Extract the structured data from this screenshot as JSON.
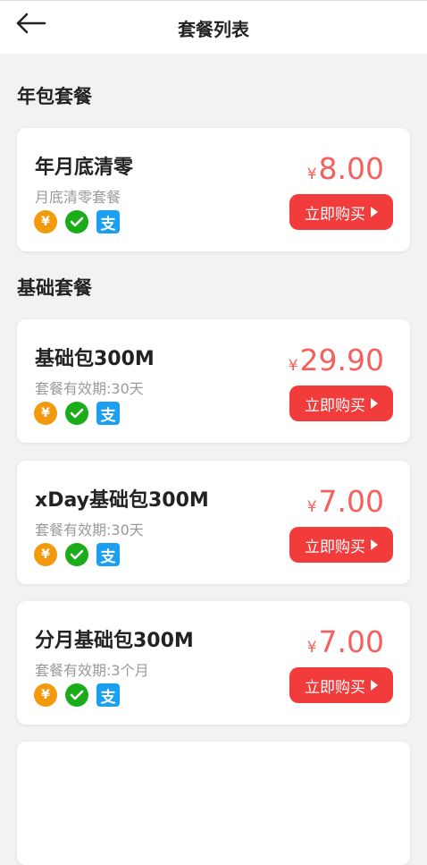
{
  "header": {
    "title": "套餐列表",
    "back_icon": "arrow-left-icon"
  },
  "sections": [
    {
      "title": "年包套餐",
      "cards": [
        {
          "name": "年月底清零",
          "subtitle": "月底清零套餐",
          "currency": "¥",
          "price": "8.00",
          "button": "立即购买"
        }
      ]
    },
    {
      "title": "基础套餐",
      "cards": [
        {
          "name": "基础包300M",
          "subtitle": "套餐有效期:30天",
          "currency": "¥",
          "price": "29.90",
          "button": "立即购买"
        },
        {
          "name": "xDay基础包300M",
          "subtitle": "套餐有效期:30天",
          "currency": "¥",
          "price": "7.00",
          "button": "立即购买"
        },
        {
          "name": "分月基础包300M",
          "subtitle": "套餐有效期:3个月",
          "currency": "¥",
          "price": "7.00",
          "button": "立即购买"
        }
      ]
    }
  ],
  "payment_icons": {
    "balance": "¥",
    "wechat": "wechat-pay-icon",
    "alipay": "支"
  },
  "colors": {
    "price": "#f3605d",
    "buy_button": "#f23b3b",
    "balance_icon": "#f29a0c",
    "wechat_icon": "#1aad19",
    "alipay_icon": "#1b9ff0"
  }
}
